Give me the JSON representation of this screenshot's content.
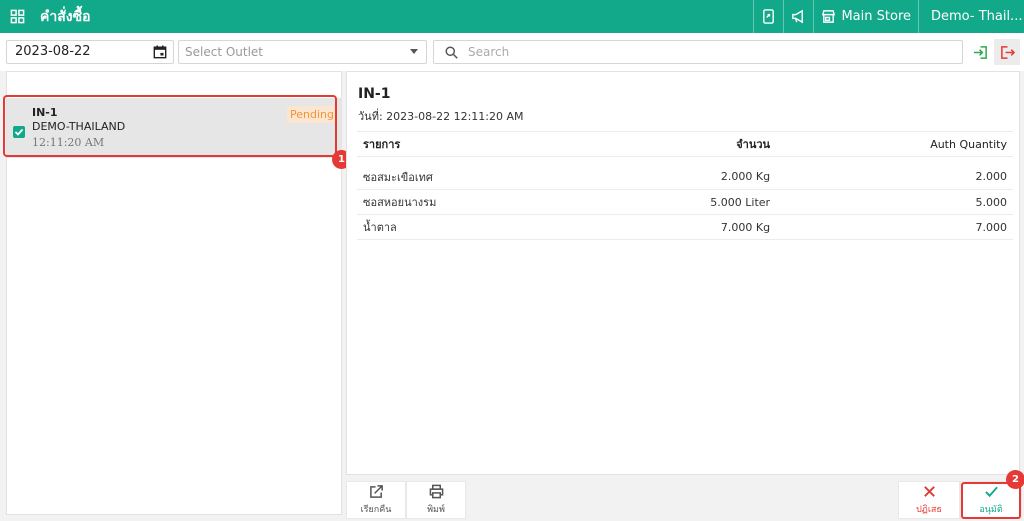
{
  "header": {
    "title": "คำสั่งซื้อ",
    "store": "Main Store",
    "user": "Demo- Thail..."
  },
  "toolbar": {
    "date": "2023-08-22",
    "outlet_placeholder": "Select Outlet",
    "search_placeholder": "Search"
  },
  "orders": [
    {
      "number": "IN-1",
      "outlet": "DEMO-THAILAND",
      "time": "12:11:20 AM",
      "status": "Pending"
    }
  ],
  "markers": [
    "1",
    "2"
  ],
  "detail": {
    "title": "IN-1",
    "date_label": "วันที่:",
    "date_value": "2023-08-22 12:11:20 AM",
    "columns": [
      "รายการ",
      "จำนวน",
      "Auth Quantity"
    ],
    "rows": [
      {
        "name": "ซอสมะเขือเทศ",
        "qty": "2.000 Kg",
        "auth": "2.000"
      },
      {
        "name": "ซอสหอยนางรม",
        "qty": "5.000 Liter",
        "auth": "5.000"
      },
      {
        "name": "น้ำตาล",
        "qty": "7.000 Kg",
        "auth": "7.000"
      }
    ]
  },
  "actions": {
    "reopen": "เรียกคืน",
    "print": "พิมพ์",
    "reject": "ปฏิเสธ",
    "approve": "อนุมัติ"
  },
  "colors": {
    "brand": "#12a88a",
    "danger": "#e53935",
    "pending": "#f0953a"
  },
  "icons": [
    "grid-icon",
    "mobile-export-icon",
    "megaphone-icon",
    "store-icon",
    "user-icon",
    "calendar-icon",
    "search-icon",
    "import-icon",
    "export-icon",
    "checkbox-icon",
    "open-external-icon",
    "printer-icon",
    "close-icon",
    "check-icon"
  ]
}
